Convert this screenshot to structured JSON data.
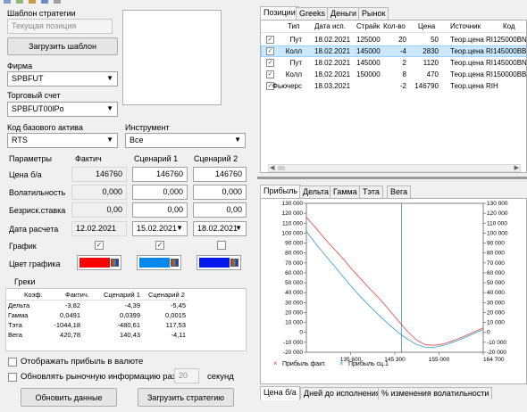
{
  "toolbar_icons": [
    "new-icon",
    "save-icon",
    "open-icon",
    "refresh-icon",
    "settings-icon"
  ],
  "template": {
    "section_label": "Шаблон стратегии",
    "current_position": "Текущая позиция",
    "load_template": "Загрузить шаблон"
  },
  "firm": {
    "label": "Фирма",
    "value": "SPBFUT"
  },
  "account": {
    "label": "Торговый счет",
    "value": "SPBFUT00lPo"
  },
  "base_asset": {
    "label": "Код базового актива",
    "value": "RTS"
  },
  "instrument": {
    "label": "Инструмент",
    "value": "Все"
  },
  "params": {
    "header": {
      "name": "Параметры",
      "actual": "Фактич",
      "s1": "Сценарий 1",
      "s2": "Сценарий 2"
    },
    "price": {
      "label": "Цена б/а",
      "actual": "146760",
      "s1": "146760",
      "s2": "146760"
    },
    "vol": {
      "label": "Волатильность",
      "actual": "0,000",
      "s1": "0,000",
      "s2": "0,000"
    },
    "rate": {
      "label": "Безриск.ставка",
      "actual": "0,00",
      "s1": "0,00",
      "s2": "0,00"
    },
    "date": {
      "label": "Дата расчета",
      "actual": "12.02.2021",
      "s1": "15.02.2021",
      "s2": "18.02.2021"
    },
    "graph": {
      "label": "График"
    },
    "color": {
      "label": "Цвет графика",
      "actual": "#ff0000",
      "s1": "#0088ee",
      "s2": "#0018ee"
    }
  },
  "greeks": {
    "title": "Греки",
    "headers": [
      "Коэф.",
      "Фактич.",
      "Сценарий 1",
      "Сценарий 2"
    ],
    "rows": [
      {
        "name": "Дельта",
        "actual": "-3,82",
        "s1": "-4,39",
        "s2": "-5,45"
      },
      {
        "name": "Гамма",
        "actual": "0,0491",
        "s1": "0,0399",
        "s2": "0,0015"
      },
      {
        "name": "Тэта",
        "actual": "-1044,18",
        "s1": "-480,61",
        "s2": "117,53"
      },
      {
        "name": "Вега",
        "actual": "420,78",
        "s1": "140,43",
        "s2": "-4,11"
      }
    ]
  },
  "options": {
    "show_profit_currency": "Отображать прибыль в валюте",
    "update_market": "Обновлять рыночную информацию раз в",
    "interval": "20",
    "seconds": "секунд"
  },
  "buttons": {
    "update": "Обновить данные",
    "load_strategy": "Загрузить стратегию"
  },
  "top_tabs": [
    "Позиции",
    "Greeks",
    "Деньги",
    "Рынок"
  ],
  "positions": {
    "headers": [
      "Тип",
      "Дата исп.",
      "Страйк",
      "Кол-во",
      "Цена",
      "Источник",
      "Код"
    ],
    "rows": [
      {
        "type": "Пут",
        "date": "18.02.2021",
        "strike": "125000",
        "qty": "20",
        "price": "50",
        "source": "Теор.цена",
        "code": "RI125000BN"
      },
      {
        "type": "Колл",
        "date": "18.02.2021",
        "strike": "145000",
        "qty": "-4",
        "price": "2830",
        "source": "Теор.цена",
        "code": "RI145000BB"
      },
      {
        "type": "Пут",
        "date": "18.02.2021",
        "strike": "145000",
        "qty": "2",
        "price": "1120",
        "source": "Теор.цена",
        "code": "RI145000BN"
      },
      {
        "type": "Колл",
        "date": "18.02.2021",
        "strike": "150000",
        "qty": "8",
        "price": "470",
        "source": "Теор.цена",
        "code": "RI150000BB"
      },
      {
        "type": "Фьючерс",
        "date": "18.03.2021",
        "strike": "",
        "qty": "-2",
        "price": "146790",
        "source": "Теор.цена",
        "code": "RIH"
      }
    ]
  },
  "chart_tabs": [
    "Прибыль",
    "Дельта",
    "Гамма",
    "Тэта",
    "Вега"
  ],
  "bottom_tabs": [
    "Цена б/а",
    "Дней до исполнения",
    "% изменения волатильности"
  ],
  "chart_data": {
    "type": "line",
    "y_ticks": [
      "130 000",
      "120 000",
      "110 000",
      "100 000",
      "90 000",
      "80 000",
      "70 000",
      "60 000",
      "50 000",
      "40 000",
      "30 000",
      "20 000",
      "10 000",
      "0",
      "-10 000",
      "-20 000"
    ],
    "ylim": [
      -20000,
      130000
    ],
    "x_tick_labels": [
      "135 600",
      "145 300",
      "155 000",
      "164 700"
    ],
    "xlim": [
      125900,
      164700
    ],
    "vline": 146760,
    "series": [
      {
        "name": "Прибыль факт.",
        "color": "#e04040",
        "marker": "×",
        "x": [
          125900,
          128000,
          130000,
          132000,
          134000,
          136000,
          138000,
          140000,
          142000,
          144000,
          146000,
          148000,
          150000,
          152000,
          154000,
          156000,
          158000,
          160000,
          162000,
          164700
        ],
        "y": [
          116000,
          105000,
          94000,
          84000,
          74000,
          63000,
          53000,
          43000,
          33500,
          23000,
          12000,
          1500,
          -7500,
          -12500,
          -13000,
          -11500,
          -8500,
          -5000,
          -1000,
          4500
        ]
      },
      {
        "name": "Прибыль сц.1",
        "color": "#3399cc",
        "marker": "×",
        "x": [
          125900,
          128000,
          130000,
          132000,
          134000,
          136000,
          138000,
          140000,
          142000,
          144000,
          146000,
          148000,
          150000,
          152000,
          154000,
          156000,
          158000,
          160000,
          162000,
          164700
        ],
        "y": [
          102000,
          89000,
          78000,
          67000,
          56000,
          45000,
          35000,
          25500,
          16500,
          8000,
          0,
          -6500,
          -12000,
          -15000,
          -15000,
          -13000,
          -10000,
          -6500,
          -2500,
          3000
        ]
      }
    ]
  }
}
